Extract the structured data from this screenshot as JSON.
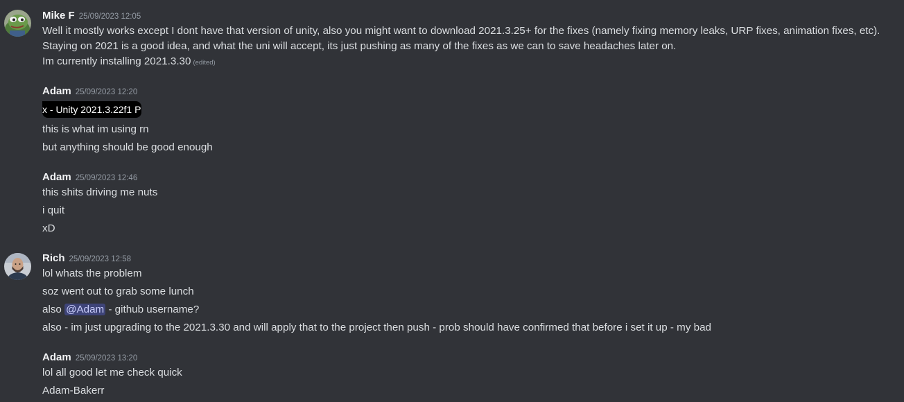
{
  "messages": [
    {
      "author": "Mike F",
      "timestamp": "25/09/2023 12:05",
      "lines": [
        "Well it mostly works except I dont have that version of unity, also you might want to download 2021.3.25+ for the fixes (namely fixing memory leaks, URP fixes, animation fixes, etc).",
        "Staying on 2021 is a good idea, and what the uni will accept, its just pushing as many of the fixes as we can to save headaches later on.",
        "Im currently installing 2021.3.30"
      ],
      "edited_label": "(edited)"
    },
    {
      "author": "Adam",
      "timestamp": "25/09/2023 12:20",
      "window_chip": "x - Unity 2021.3.22f1 P",
      "lines": [
        "this is what im using rn",
        "but anything should be good enough"
      ]
    },
    {
      "author": "Adam",
      "timestamp": "25/09/2023 12:46",
      "lines": [
        "this shits driving me nuts",
        "i quit",
        "xD"
      ]
    },
    {
      "author": "Rich",
      "timestamp": "25/09/2023 12:58",
      "lines": [
        "lol whats the problem",
        "soz went out to grab some lunch"
      ],
      "mention_line": {
        "prefix": "also ",
        "mention": "@Adam",
        "suffix": " - github username?"
      },
      "last_line": "also - im just upgrading to the 2021.3.30 and will apply that to the project then push - prob should have confirmed that before i set it up - my bad"
    },
    {
      "author": "Adam",
      "timestamp": "25/09/2023 13:20",
      "lines": [
        "lol all good let me check quick",
        "Adam-Bakerr"
      ]
    }
  ],
  "colors": {
    "background": "#313338",
    "author": "#f2f3f5",
    "text": "#dbdee1",
    "timestamp": "#949ba4",
    "mention_bg": "#5865f2"
  },
  "icons": {
    "mike_avatar": "frog-avatar-icon",
    "rich_avatar": "person-avatar-icon"
  }
}
